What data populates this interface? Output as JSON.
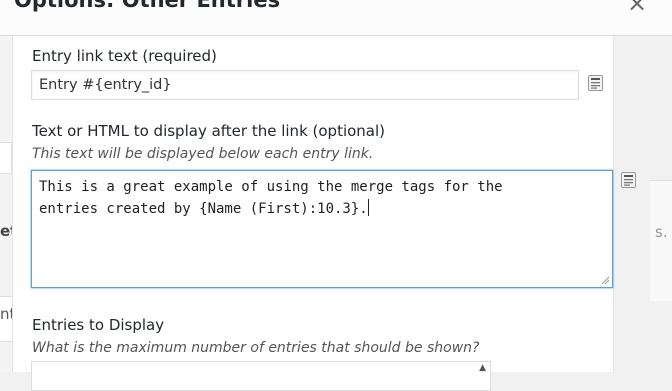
{
  "modal": {
    "title": "Options: Other Entries",
    "close_glyph": "×"
  },
  "background": {
    "left_fragment": "et",
    "left_fragment2": "nt",
    "right_fragment": "s."
  },
  "fields": {
    "link_text": {
      "label": "Entry link text (required)",
      "value": "Entry #{entry_id}"
    },
    "after_link": {
      "label": "Text or HTML to display after the link (optional)",
      "description": "This text will be displayed below each entry link.",
      "value_line1": "This is a great example of using the merge tags for the",
      "value_line2": "entries created by {Name (First):10.3}."
    },
    "entries_to_display": {
      "label": "Entries to Display",
      "description": "What is the maximum number of entries that should be shown?"
    }
  },
  "icons": {
    "merge_tag": "merge-tags-icon",
    "close": "close-icon",
    "resize": "resize-grip-icon"
  }
}
